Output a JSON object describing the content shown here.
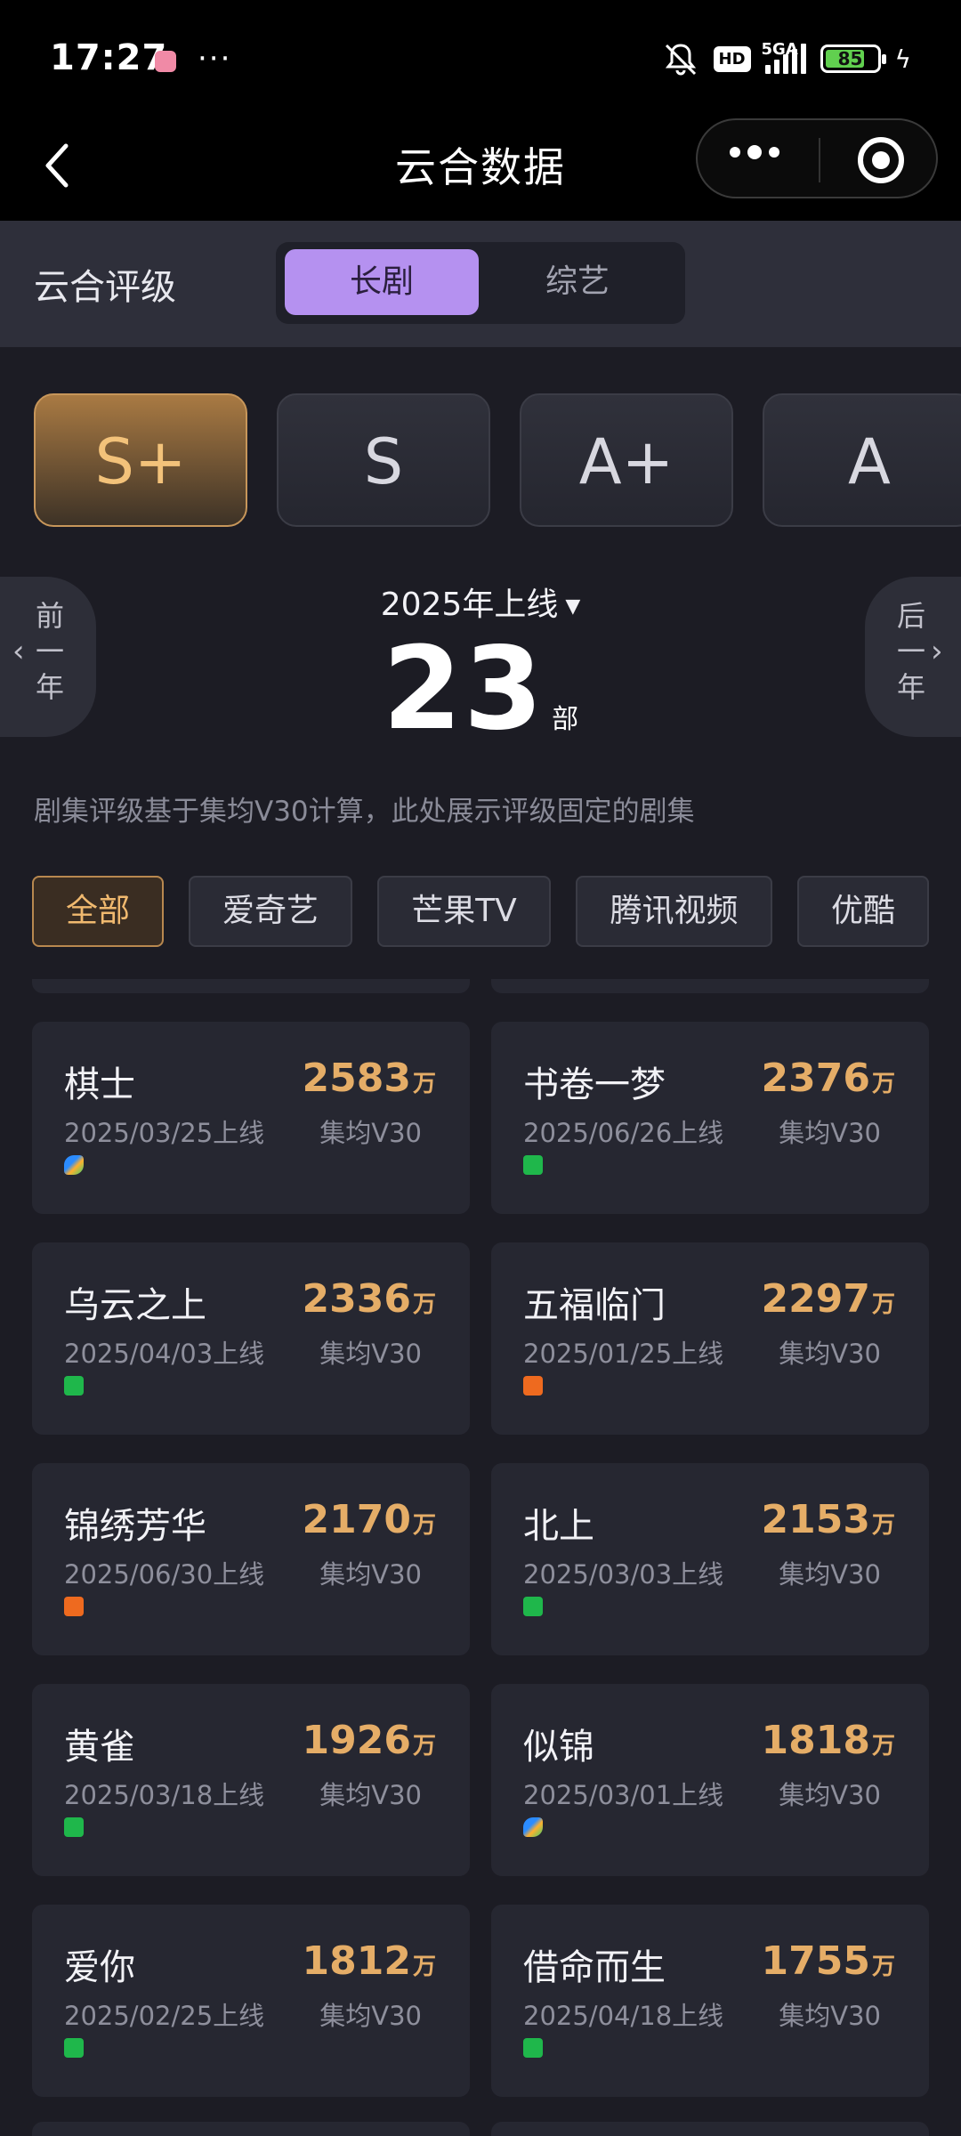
{
  "status_bar": {
    "time": "17:27",
    "dots": "···",
    "network": "5GA",
    "hd": "HD",
    "battery": "85",
    "charging": "ϟ"
  },
  "header": {
    "title": "云合数据"
  },
  "rating": {
    "label": "云合评级",
    "options": [
      "长剧",
      "综艺"
    ],
    "selected": "长剧"
  },
  "grades": {
    "items": [
      "S+",
      "S",
      "A+",
      "A"
    ],
    "selected": "S+"
  },
  "year": {
    "prev": [
      "前",
      "一",
      "年"
    ],
    "next": [
      "后",
      "一",
      "年"
    ],
    "selected": "2025年上线",
    "count": "23",
    "unit": "部"
  },
  "note": "剧集评级基于集均V30计算，此处展示评级固定的剧集",
  "platforms": {
    "items": [
      "全部",
      "爱奇艺",
      "芒果TV",
      "腾讯视频",
      "优酷"
    ],
    "selected": "全部"
  },
  "unit_wan": "万",
  "metric_label": "集均V30",
  "dramas": [
    {
      "name": "棋士",
      "date": "2025/03/25上线",
      "value": "2583",
      "platform": "tencent"
    },
    {
      "name": "书卷一梦",
      "date": "2025/06/26上线",
      "value": "2376",
      "platform": "iqiyi"
    },
    {
      "name": "乌云之上",
      "date": "2025/04/03上线",
      "value": "2336",
      "platform": "iqiyi"
    },
    {
      "name": "五福临门",
      "date": "2025/01/25上线",
      "value": "2297",
      "platform": "mango"
    },
    {
      "name": "锦绣芳华",
      "date": "2025/06/30上线",
      "value": "2170",
      "platform": "mango"
    },
    {
      "name": "北上",
      "date": "2025/03/03上线",
      "value": "2153",
      "platform": "iqiyi"
    },
    {
      "name": "黄雀",
      "date": "2025/03/18上线",
      "value": "1926",
      "platform": "iqiyi"
    },
    {
      "name": "似锦",
      "date": "2025/03/01上线",
      "value": "1818",
      "platform": "tencent"
    },
    {
      "name": "爱你",
      "date": "2025/02/25上线",
      "value": "1812",
      "platform": "iqiyi"
    },
    {
      "name": "借命而生",
      "date": "2025/04/18上线",
      "value": "1755",
      "platform": "iqiyi"
    }
  ]
}
